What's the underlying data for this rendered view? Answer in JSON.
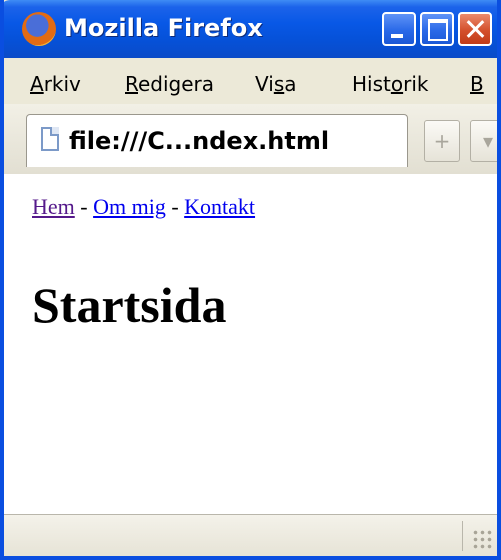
{
  "window": {
    "title": "Mozilla Firefox"
  },
  "menu": {
    "items": [
      {
        "prefix": "",
        "accel": "A",
        "rest": "rkiv"
      },
      {
        "prefix": "",
        "accel": "R",
        "rest": "edigera"
      },
      {
        "prefix": "Vi",
        "accel": "s",
        "rest": "a"
      },
      {
        "prefix": "Hist",
        "accel": "o",
        "rest": "rik"
      },
      {
        "prefix": "",
        "accel": "B",
        "rest": ""
      }
    ]
  },
  "tabs": {
    "active_label": "file:///C...ndex.html",
    "new_tab_symbol": "+",
    "scroll_symbol": "▾"
  },
  "page": {
    "nav": [
      {
        "label": "Hem",
        "visited": true
      },
      {
        "label": "Om mig",
        "visited": false
      },
      {
        "label": "Kontakt",
        "visited": false
      }
    ],
    "separator": " - ",
    "heading": "Startsida"
  },
  "colors": {
    "titlebar": "#0858e6",
    "link": "#0000ee",
    "visited_link": "#551a8b",
    "chrome": "#ece9d8"
  },
  "icons": [
    "firefox-logo-icon",
    "minimize-icon",
    "maximize-icon",
    "close-icon",
    "page-icon",
    "resize-grip-icon"
  ]
}
